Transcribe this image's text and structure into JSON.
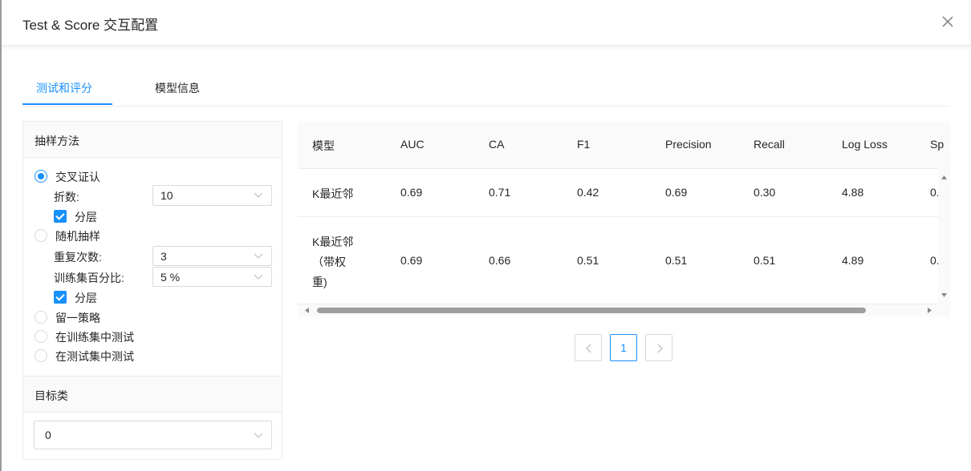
{
  "dialog": {
    "title": "Test & Score 交互配置",
    "close_icon": "close-icon"
  },
  "tabs": [
    {
      "label": "测试和评分",
      "active": true
    },
    {
      "label": "模型信息",
      "active": false
    }
  ],
  "sampling": {
    "title": "抽样方法",
    "options": {
      "cross_validation": {
        "label": "交叉证认",
        "selected": true
      },
      "folds_label": "折数:",
      "folds_value": "10",
      "stratified1": {
        "label": "分层",
        "checked": true
      },
      "random_sampling": {
        "label": "随机抽样",
        "selected": false
      },
      "repeat_label": "重复次数:",
      "repeat_value": "3",
      "train_pct_label": "训练集百分比:",
      "train_pct_value": "5 %",
      "stratified2": {
        "label": "分层",
        "checked": true
      },
      "leave_one_out": {
        "label": "留一策略",
        "selected": false
      },
      "test_on_train": {
        "label": "在训练集中测试",
        "selected": false
      },
      "test_on_test": {
        "label": "在测试集中测试",
        "selected": false
      }
    }
  },
  "target": {
    "title": "目标类",
    "value": "0"
  },
  "table": {
    "columns": [
      "模型",
      "AUC",
      "CA",
      "F1",
      "Precision",
      "Recall",
      "Log Loss",
      "Sp"
    ],
    "rows": [
      {
        "model_lines": [
          "K最近邻"
        ],
        "auc": "0.69",
        "ca": "0.71",
        "f1": "0.42",
        "precision": "0.69",
        "recall": "0.30",
        "logloss": "4.88",
        "sp": "0."
      },
      {
        "model_lines": [
          "K最近邻",
          "（带权",
          "重)"
        ],
        "auc": "0.69",
        "ca": "0.66",
        "f1": "0.51",
        "precision": "0.51",
        "recall": "0.51",
        "logloss": "4.89",
        "sp": "0."
      }
    ]
  },
  "pagination": {
    "current": "1"
  },
  "colors": {
    "accent": "#1890ff",
    "border": "#d9d9d9",
    "header_bg": "#fafafa"
  }
}
